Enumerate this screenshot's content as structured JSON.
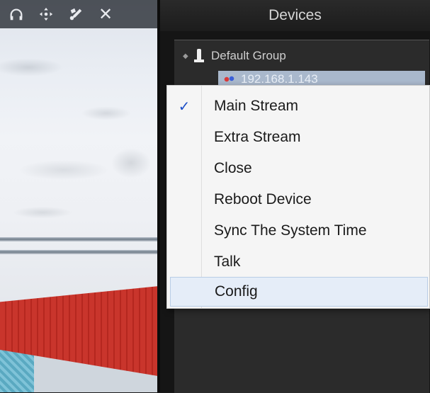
{
  "toolbar": {
    "icons": [
      "headphones-icon",
      "move-icon",
      "edit-icon",
      "close-icon"
    ],
    "close_glyph": "✕"
  },
  "devices_panel": {
    "title": "Devices",
    "group": {
      "label": "Default Group"
    },
    "device": {
      "label": "192.168.1.143"
    }
  },
  "context_menu": {
    "items": [
      {
        "label": "Main Stream",
        "checked": true,
        "check_glyph": "✓"
      },
      {
        "label": "Extra Stream",
        "checked": false
      },
      {
        "label": "Close",
        "checked": false
      },
      {
        "label": "Reboot Device",
        "checked": false
      },
      {
        "label": "Sync The System Time",
        "checked": false
      },
      {
        "label": "Talk",
        "checked": false
      },
      {
        "label": "Config",
        "checked": false,
        "highlighted": true
      }
    ]
  },
  "colors": {
    "selected_device_bg": "#a9b8cc",
    "menu_bg": "#f5f5f5",
    "check_color": "#1d4fc7",
    "menu_highlight": "#e5edf8"
  }
}
